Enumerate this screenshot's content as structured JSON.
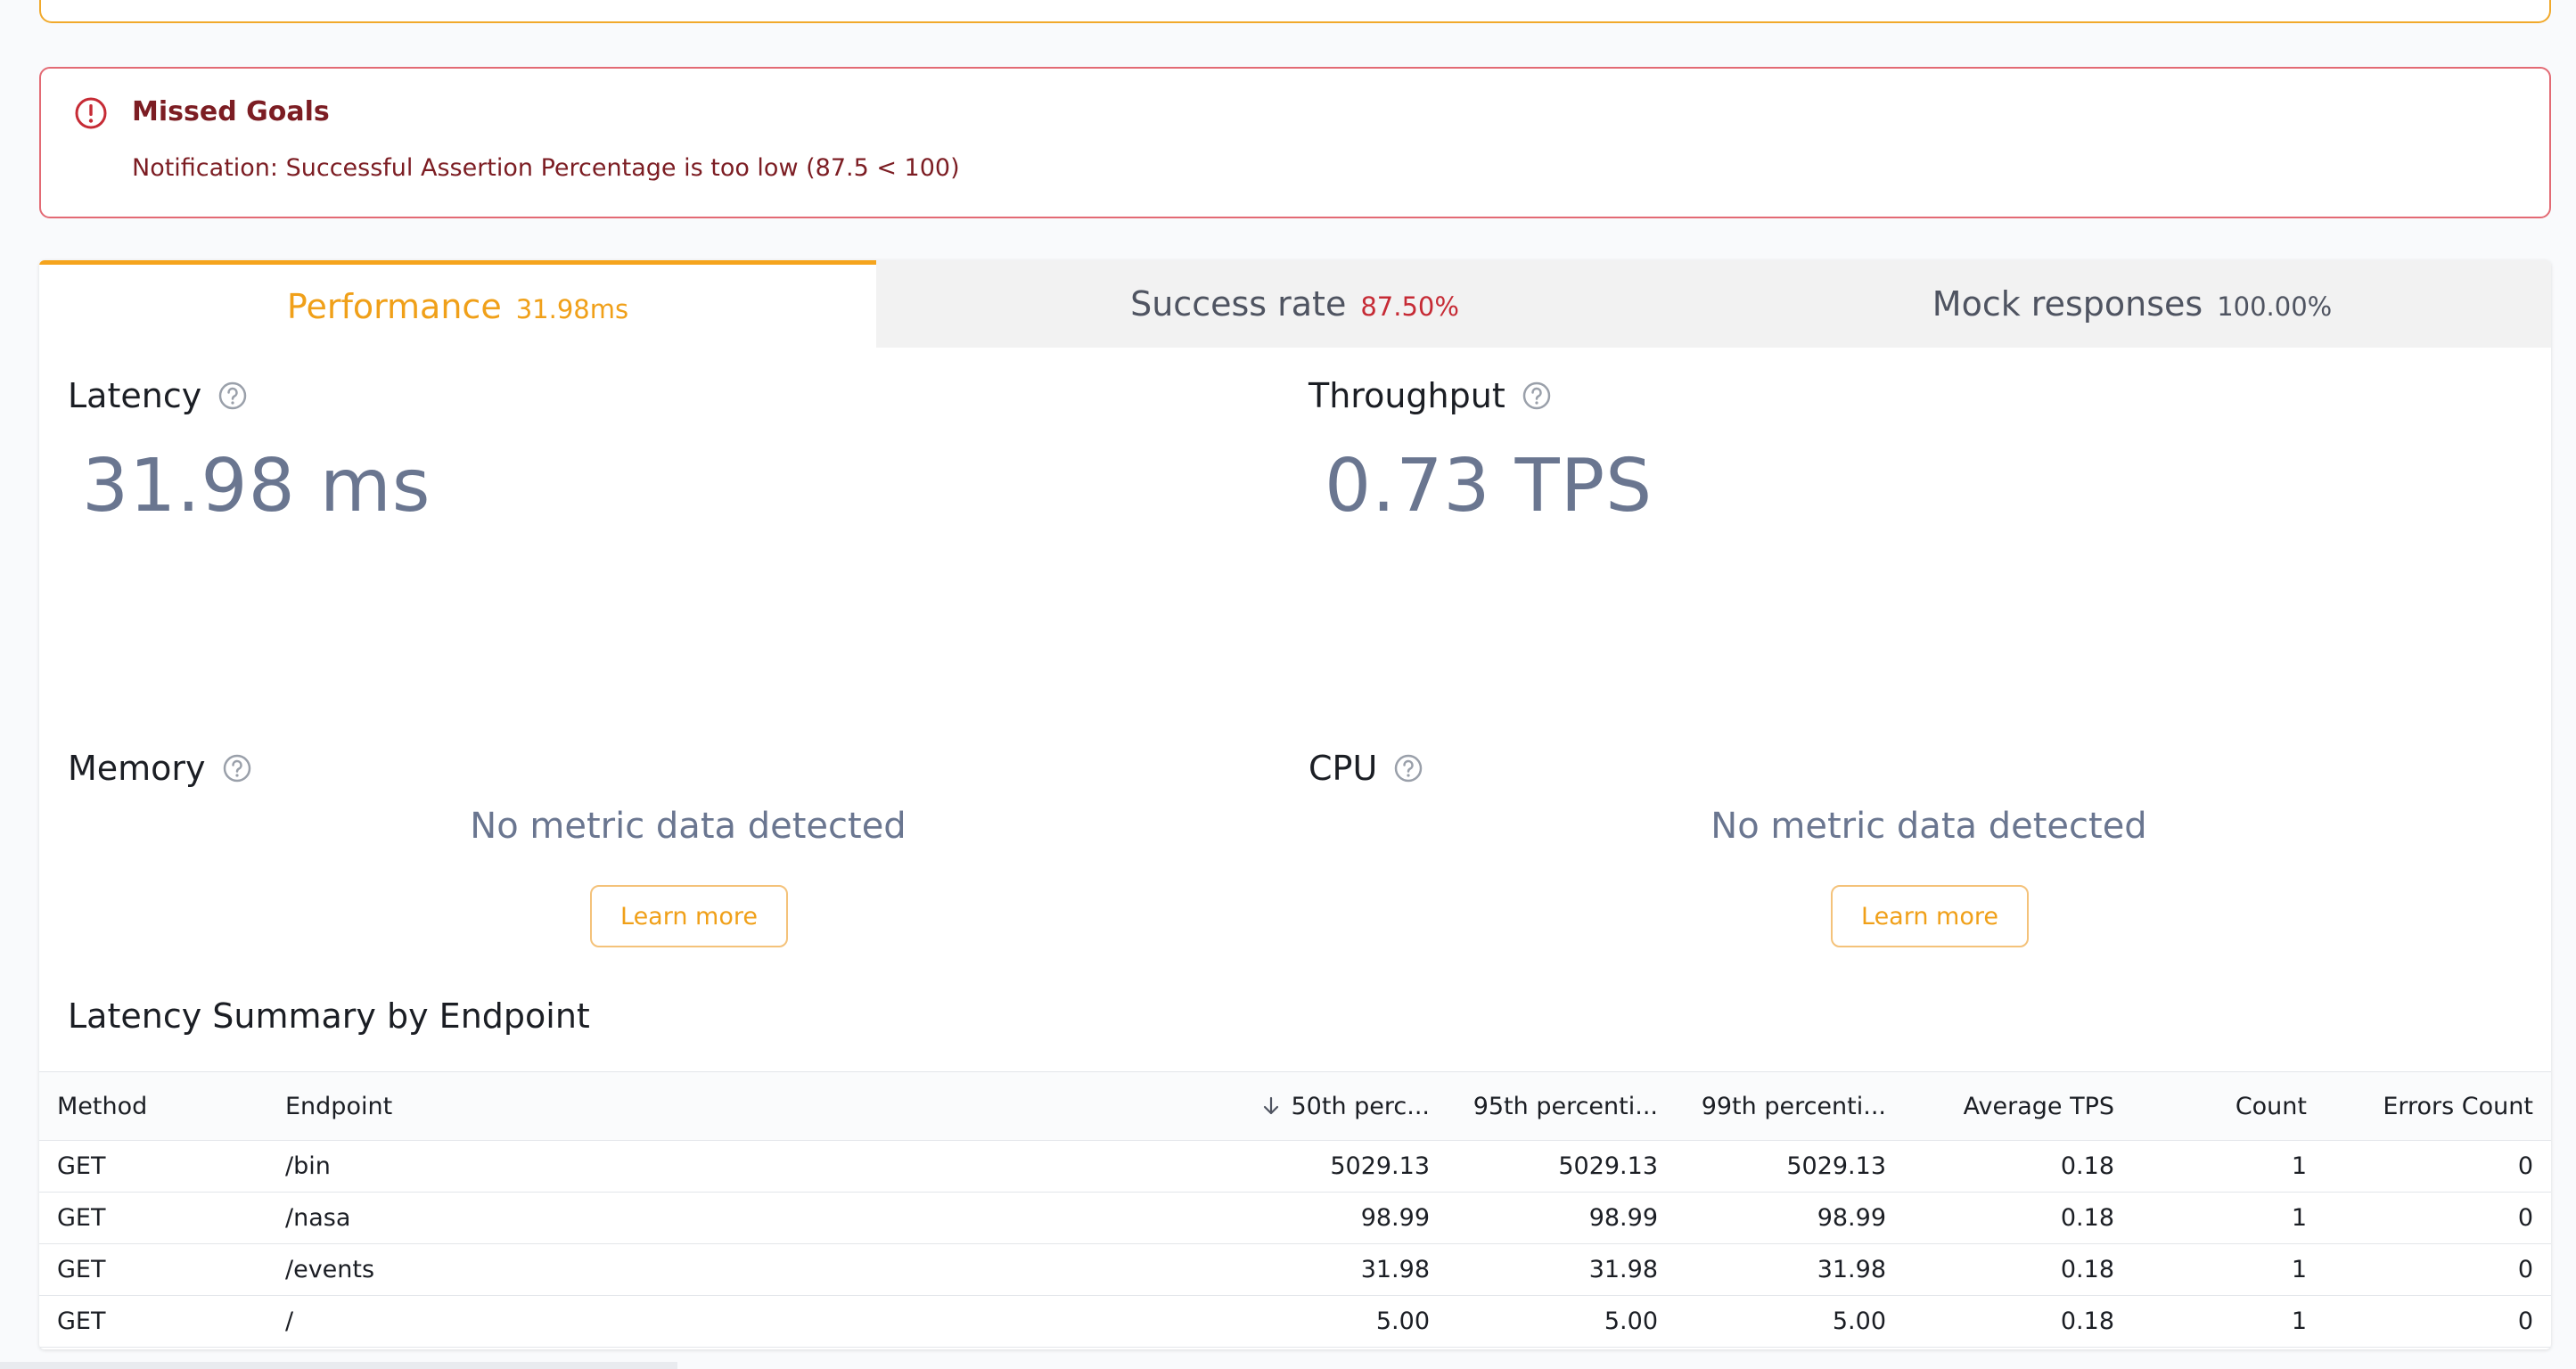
{
  "alert": {
    "title": "Missed Goals",
    "message": "Notification: Successful Assertion Percentage is too low (87.5 < 100)",
    "color": "#c62b35"
  },
  "tabs": [
    {
      "label": "Performance",
      "value": "31.98ms",
      "active": true
    },
    {
      "label": "Success rate",
      "value": "87.50%"
    },
    {
      "label": "Mock responses",
      "value": "100.00%"
    }
  ],
  "latency": {
    "title": "Latency",
    "value": "31.98 ms"
  },
  "throughput": {
    "title": "Throughput",
    "value": "0.73 TPS"
  },
  "memory": {
    "title": "Memory",
    "empty_text": "No metric data detected",
    "button": "Learn more"
  },
  "cpu": {
    "title": "CPU",
    "empty_text": "No metric data detected",
    "button": "Learn more"
  },
  "summary": {
    "title": "Latency Summary by Endpoint",
    "columns": [
      "Method",
      "Endpoint",
      "50th perc...",
      "95th percenti...",
      "99th percenti...",
      "Average TPS",
      "Count",
      "Errors Count"
    ],
    "rows": [
      [
        "GET",
        "/bin",
        "5029.13",
        "5029.13",
        "5029.13",
        "0.18",
        "1",
        "0"
      ],
      [
        "GET",
        "/nasa",
        "98.99",
        "98.99",
        "98.99",
        "0.18",
        "1",
        "0"
      ],
      [
        "GET",
        "/events",
        "31.98",
        "31.98",
        "31.98",
        "0.18",
        "1",
        "0"
      ],
      [
        "GET",
        "/",
        "5.00",
        "5.00",
        "5.00",
        "0.18",
        "1",
        "0"
      ]
    ]
  },
  "colors": {
    "accent": "#f0a019",
    "error": "#c62b35",
    "metric": "#6a7690"
  }
}
